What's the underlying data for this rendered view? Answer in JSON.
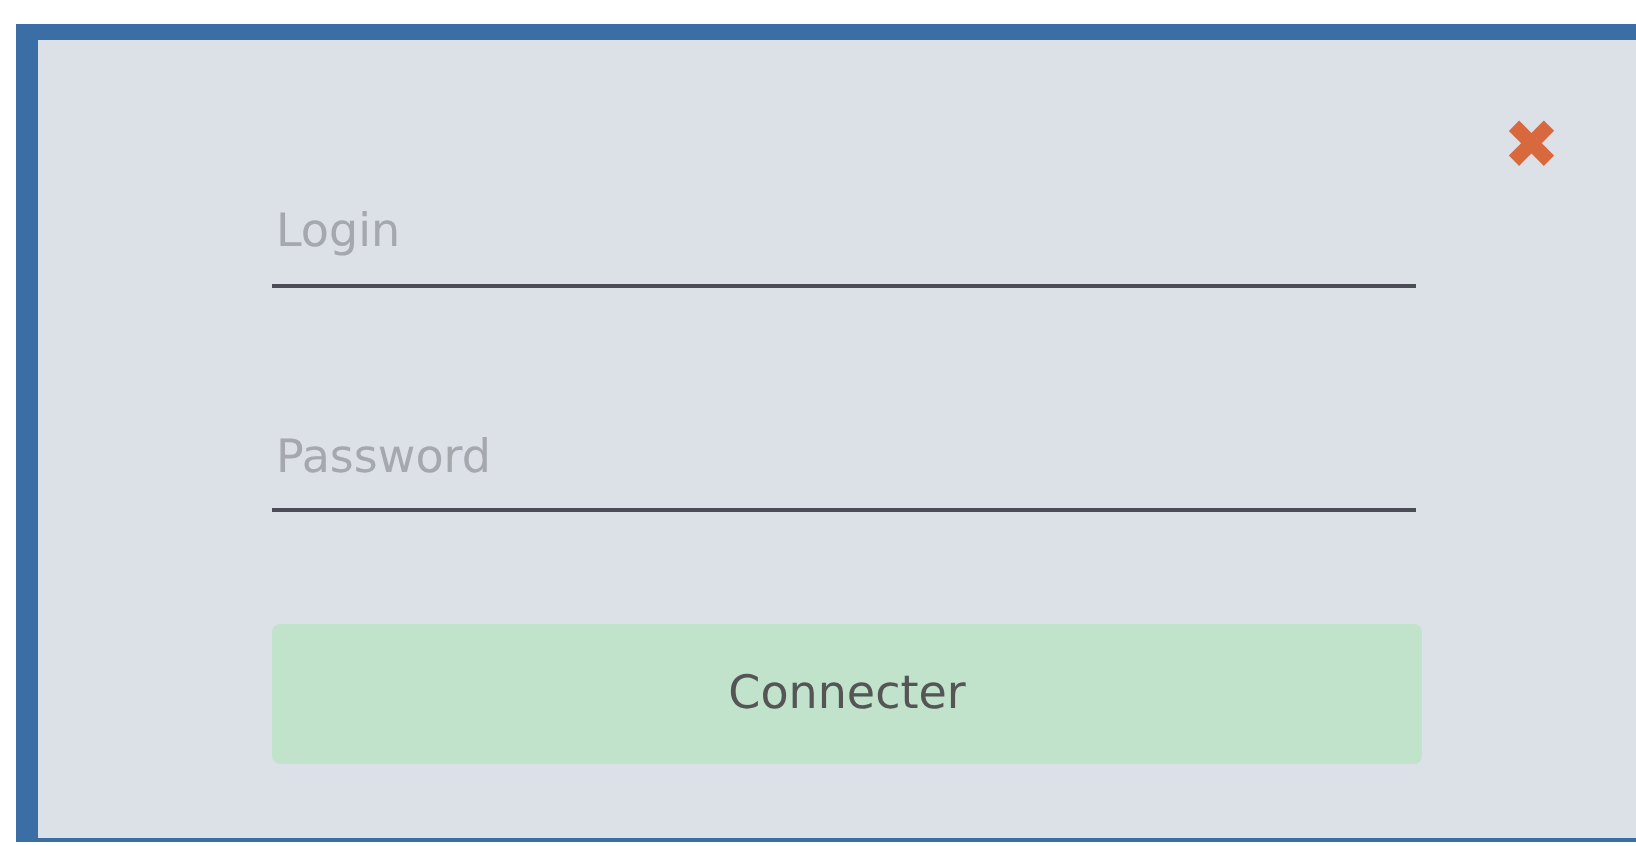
{
  "dialog": {
    "close_button": "✖",
    "fields": [
      {
        "placeholder": "Login"
      },
      {
        "placeholder": "Password"
      }
    ],
    "submit_button": "Connecter"
  }
}
